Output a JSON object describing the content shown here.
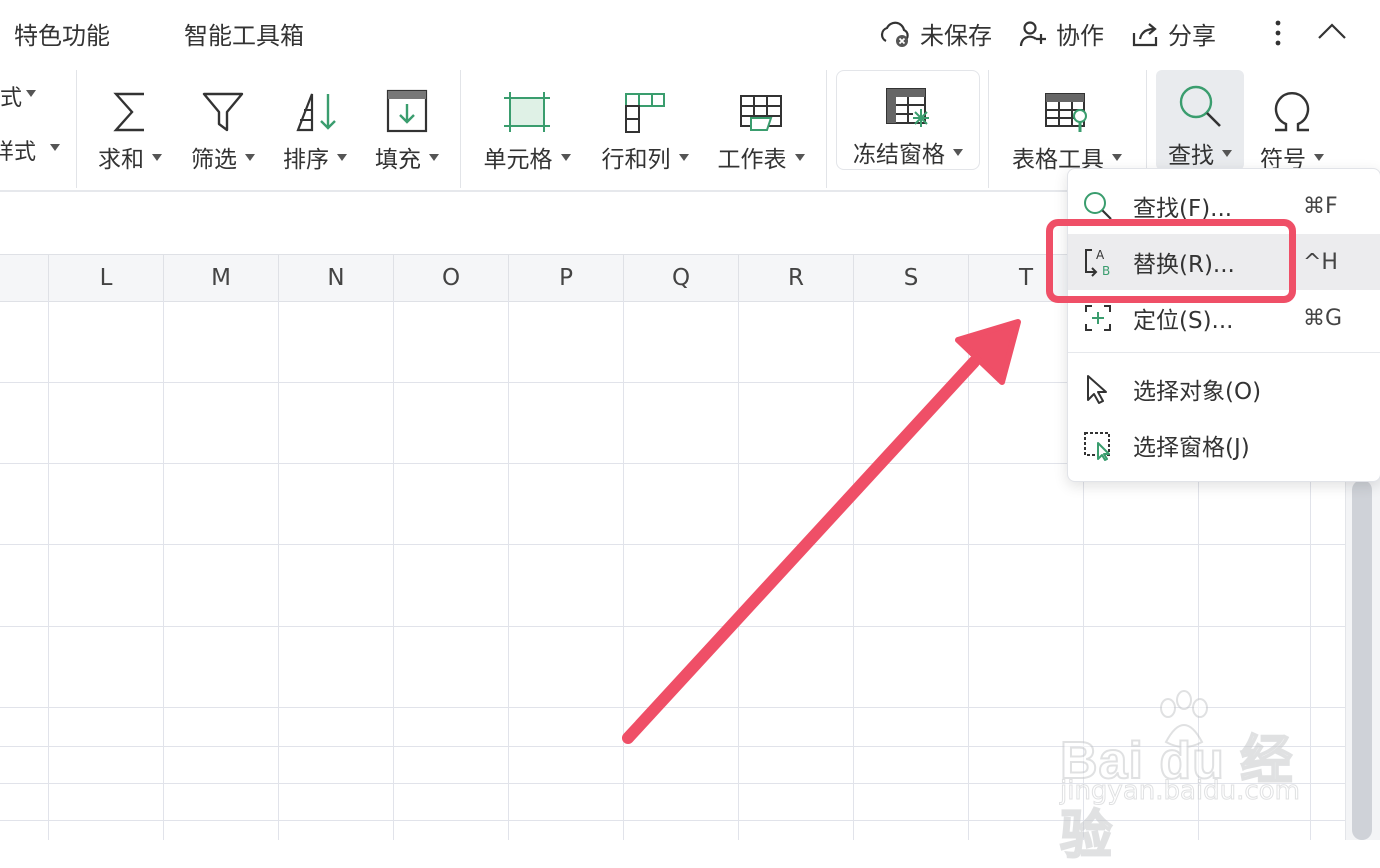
{
  "topbar": {
    "tabs": [
      "特色功能",
      "智能工具箱"
    ],
    "unsaved_label": "未保存",
    "collab_label": "协作",
    "share_label": "分享"
  },
  "ribbon": {
    "partial_top": "式",
    "partial_bottom": "样式",
    "buttons": [
      "求和",
      "筛选",
      "排序",
      "填充",
      "单元格",
      "行和列",
      "工作表",
      "冻结窗格",
      "表格工具",
      "查找",
      "符号"
    ]
  },
  "columns": [
    "L",
    "M",
    "N",
    "O",
    "P",
    "Q",
    "R",
    "S",
    "T"
  ],
  "menu": {
    "items": [
      {
        "label": "查找(F)...",
        "shortcut": "⌘F",
        "icon": "search-icon"
      },
      {
        "label": "替换(R)...",
        "shortcut": "^H",
        "icon": "replace-icon"
      },
      {
        "label": "定位(S)...",
        "shortcut": "⌘G",
        "icon": "locate-icon"
      },
      {
        "label": "选择对象(O)",
        "shortcut": "",
        "icon": "pointer-icon"
      },
      {
        "label": "选择窗格(J)",
        "shortcut": "",
        "icon": "selection-pane-icon"
      }
    ]
  },
  "colors": {
    "accent_green": "#3a9d6e",
    "annotation_red": "#ef4f67",
    "icon_gray": "#333333"
  },
  "watermark": {
    "brand": "Bai du 经验",
    "url": "jingyan.baidu.com"
  }
}
